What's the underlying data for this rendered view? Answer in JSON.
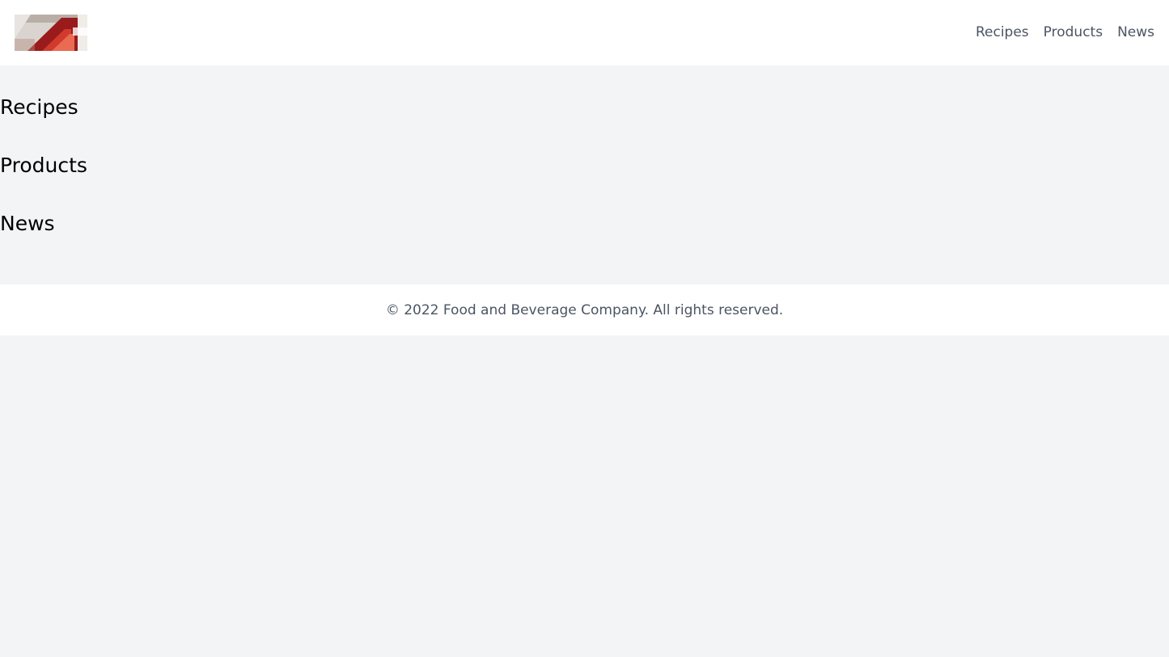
{
  "header": {
    "logo_icon": "red-diagonal-image-logo",
    "nav": [
      {
        "label": "Recipes"
      },
      {
        "label": "Products"
      },
      {
        "label": "News"
      }
    ]
  },
  "main": {
    "sections": [
      {
        "title": "Recipes"
      },
      {
        "title": "Products"
      },
      {
        "title": "News"
      }
    ]
  },
  "footer": {
    "copyright": "© 2022 Food and Beverage Company. All rights reserved."
  },
  "colors": {
    "page_background": "#f3f4f6",
    "header_background": "#ffffff",
    "nav_text": "#4b5563",
    "heading_text": "#000000",
    "footer_text": "#4b5563"
  }
}
